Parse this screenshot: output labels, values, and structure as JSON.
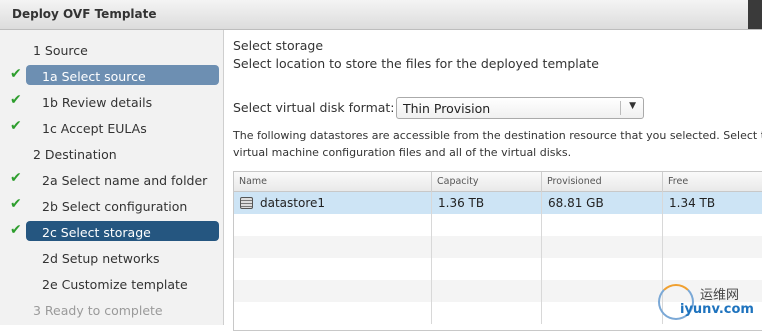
{
  "window": {
    "title": "Deploy OVF Template"
  },
  "sidebar": {
    "steps": [
      {
        "label": "1 Source",
        "checked": false,
        "state": "normal"
      },
      {
        "label": "1a Select source",
        "checked": true,
        "state": "selected-light"
      },
      {
        "label": "1b Review details",
        "checked": true,
        "state": "normal"
      },
      {
        "label": "1c Accept EULAs",
        "checked": true,
        "state": "normal"
      },
      {
        "label": "2 Destination",
        "checked": false,
        "state": "normal"
      },
      {
        "label": "2a Select name and folder",
        "checked": true,
        "state": "normal"
      },
      {
        "label": "2b Select configuration",
        "checked": true,
        "state": "normal"
      },
      {
        "label": "2c Select storage",
        "checked": true,
        "state": "selected-dark"
      },
      {
        "label": "2d Setup networks",
        "checked": false,
        "state": "normal"
      },
      {
        "label": "2e Customize template",
        "checked": false,
        "state": "normal"
      },
      {
        "label": "3 Ready to complete",
        "checked": false,
        "state": "disabled"
      }
    ],
    "check_glyph": "✔"
  },
  "main": {
    "heading": "Select storage",
    "subheading": "Select location to store the files for the deployed template",
    "disk_format_label": "Select virtual disk format:",
    "disk_format_value": "Thin Provision",
    "description_line1": "The following datastores are accessible from the destination resource that you selected. Select th",
    "description_line2": "virtual machine configuration files and all of the virtual disks."
  },
  "table": {
    "columns": [
      "Name",
      "Capacity",
      "Provisioned",
      "Free"
    ],
    "rows": [
      {
        "name": "datastore1",
        "capacity": "1.36 TB",
        "provisioned": "68.81 GB",
        "free": "1.34 TB"
      }
    ]
  },
  "watermark": {
    "cn": "运维网",
    "en": "iyunv.com"
  },
  "colors": {
    "selected_light": "#6d8fb2",
    "selected_dark": "#255680",
    "check": "#2e9e2e",
    "row_selected": "#cde4f5"
  }
}
